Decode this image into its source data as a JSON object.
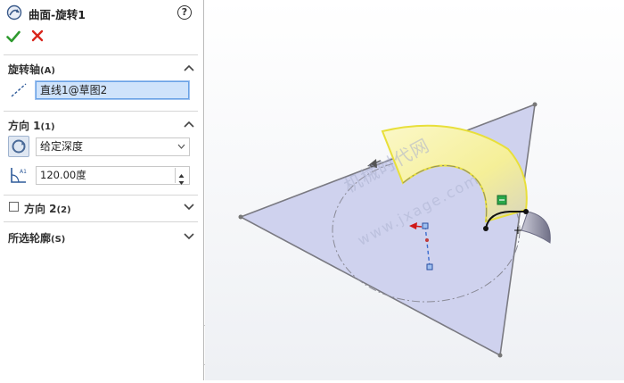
{
  "panel": {
    "title": "曲面-旋转1",
    "help_symbol": "?",
    "axis_section": {
      "title": "旋转轴",
      "shortcut": "(A)",
      "axis_value": "直线1@草图2"
    },
    "direction1": {
      "title": "方向 1",
      "shortcut": "(1)",
      "end_condition": "给定深度",
      "angle": "120.00度"
    },
    "direction2": {
      "title": "方向 2",
      "shortcut": "(2)",
      "checked": false
    },
    "contours": {
      "title": "所选轮廓",
      "shortcut": "(S)"
    }
  },
  "viewport": {
    "watermark_main": "机械时代网",
    "watermark_url": "www.jxage.com"
  },
  "colors": {
    "ok_green": "#2e9a2e",
    "cancel_red": "#d9261c",
    "plane_fill": "#cfd2ee",
    "surface_yellow": "#f7f29a",
    "selection_blue": "#cfe3fb"
  }
}
